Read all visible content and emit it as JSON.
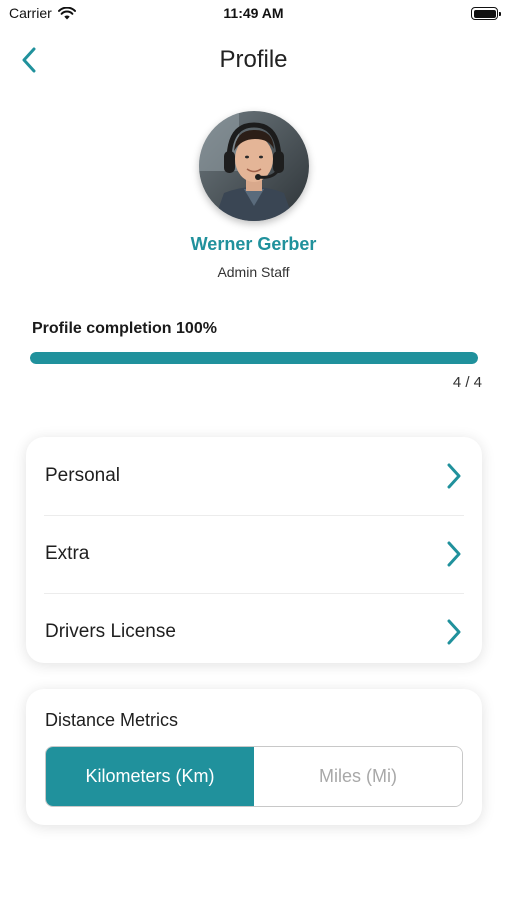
{
  "status_bar": {
    "carrier": "Carrier",
    "time": "11:49 AM"
  },
  "nav": {
    "title": "Profile",
    "back_icon": "chevron-left-icon"
  },
  "profile": {
    "name": "Werner Gerber",
    "role": "Admin Staff"
  },
  "completion": {
    "label": "Profile completion 100%",
    "percent": 100,
    "count": "4 / 4"
  },
  "menu": {
    "items": [
      {
        "label": "Personal",
        "icon": "chevron-right-icon"
      },
      {
        "label": "Extra",
        "icon": "chevron-right-icon"
      },
      {
        "label": "Drivers License",
        "icon": "chevron-right-icon"
      }
    ]
  },
  "distance_metrics": {
    "title": "Distance Metrics",
    "options": [
      "Kilometers (Km)",
      "Miles (Mi)"
    ],
    "selected": "Kilometers (Km)"
  },
  "colors": {
    "accent": "#20919c",
    "background": "#ffffff"
  }
}
